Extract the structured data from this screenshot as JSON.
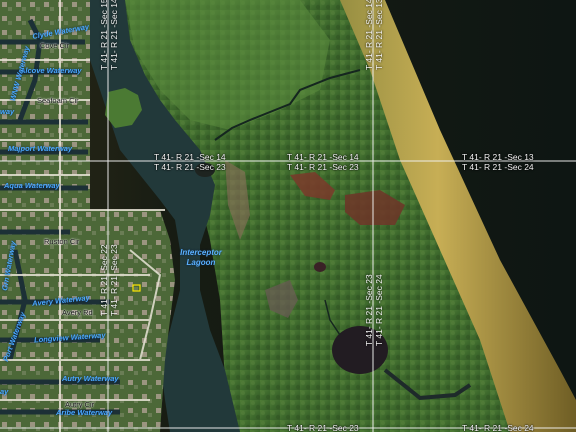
{
  "map": {
    "type": "aerial-parcel-map",
    "colors": {
      "ocean": "#141a12",
      "beach": "#b7a14a",
      "mangrove": "#3f6a2c",
      "canal": "#233a3a",
      "grid_line": "#f2f2f2",
      "water_label": "#4aa8ff",
      "marsh_red": "#7a3a2a"
    },
    "section_labels": [
      {
        "id": "s14-left-top",
        "text": "T 41- R 21 -Sec 14"
      },
      {
        "id": "s23-left-bot",
        "text": "T 41- R 21 -Sec 23"
      },
      {
        "id": "s14-mid-top",
        "text": "T 41- R 21 -Sec 14"
      },
      {
        "id": "s23-mid-bot",
        "text": "T 41- R 21 -Sec 23"
      },
      {
        "id": "s13-right-top",
        "text": "T 41- R 21 -Sec 13"
      },
      {
        "id": "s24-right-bot",
        "text": "T 41- R 21 -Sec 24"
      },
      {
        "id": "s23-bottom",
        "text": "T 41- R 21 -Sec 23"
      },
      {
        "id": "s24-bottom",
        "text": "T 41- R 21 -Sec 24"
      }
    ],
    "vertical_section_labels": [
      {
        "id": "v-top-left-a",
        "text": "T 41- R 21 -Sec 15"
      },
      {
        "id": "v-top-left-b",
        "text": "T 41- R 21 -Sec 14"
      },
      {
        "id": "v-top-right-a",
        "text": "T 41- R 21 -Sec 14"
      },
      {
        "id": "v-top-right-b",
        "text": "T 41- R 21 -Sec 13"
      },
      {
        "id": "v-mid-left-a",
        "text": "T 41- R 21 -Sec 22"
      },
      {
        "id": "v-mid-left-b",
        "text": "T 41- R 21 -Sec 23"
      },
      {
        "id": "v-mid-right-a",
        "text": "T 41- R 21 -Sec 23"
      },
      {
        "id": "v-mid-right-b",
        "text": "T 41- R 21 -Sec 24"
      }
    ],
    "waterways": [
      {
        "id": "clyde",
        "text": "Clyde Waterway"
      },
      {
        "id": "alcove",
        "text": "Alcove Waterway"
      },
      {
        "id": "majport",
        "text": "Majport Waterway"
      },
      {
        "id": "aqua",
        "text": "Aqua Waterway"
      },
      {
        "id": "avery",
        "text": "Avery Waterway"
      },
      {
        "id": "longview",
        "text": "Longview Waterway"
      },
      {
        "id": "autry",
        "text": "Autry Waterway"
      },
      {
        "id": "aribe",
        "text": "Aribe Waterway"
      },
      {
        "id": "way-left",
        "text": "way"
      },
      {
        "id": "ay-left",
        "text": "ay"
      },
      {
        "id": "wnw",
        "text": "WNW Waterway"
      },
      {
        "id": "grn",
        "text": "Grn Waterway"
      },
      {
        "id": "port",
        "text": "Port Waterway"
      }
    ],
    "streets": [
      {
        "id": "cove",
        "text": "Cove Cir"
      },
      {
        "id": "seafoam",
        "text": "Seafoam Cir"
      },
      {
        "id": "ruston",
        "text": "Ruston Cir"
      },
      {
        "id": "avery-rd",
        "text": "Avery Rd"
      },
      {
        "id": "autry-cir",
        "text": "Autry Cir"
      }
    ],
    "lagoon": {
      "line1": "Interceptor",
      "line2": "Lagoon"
    }
  }
}
